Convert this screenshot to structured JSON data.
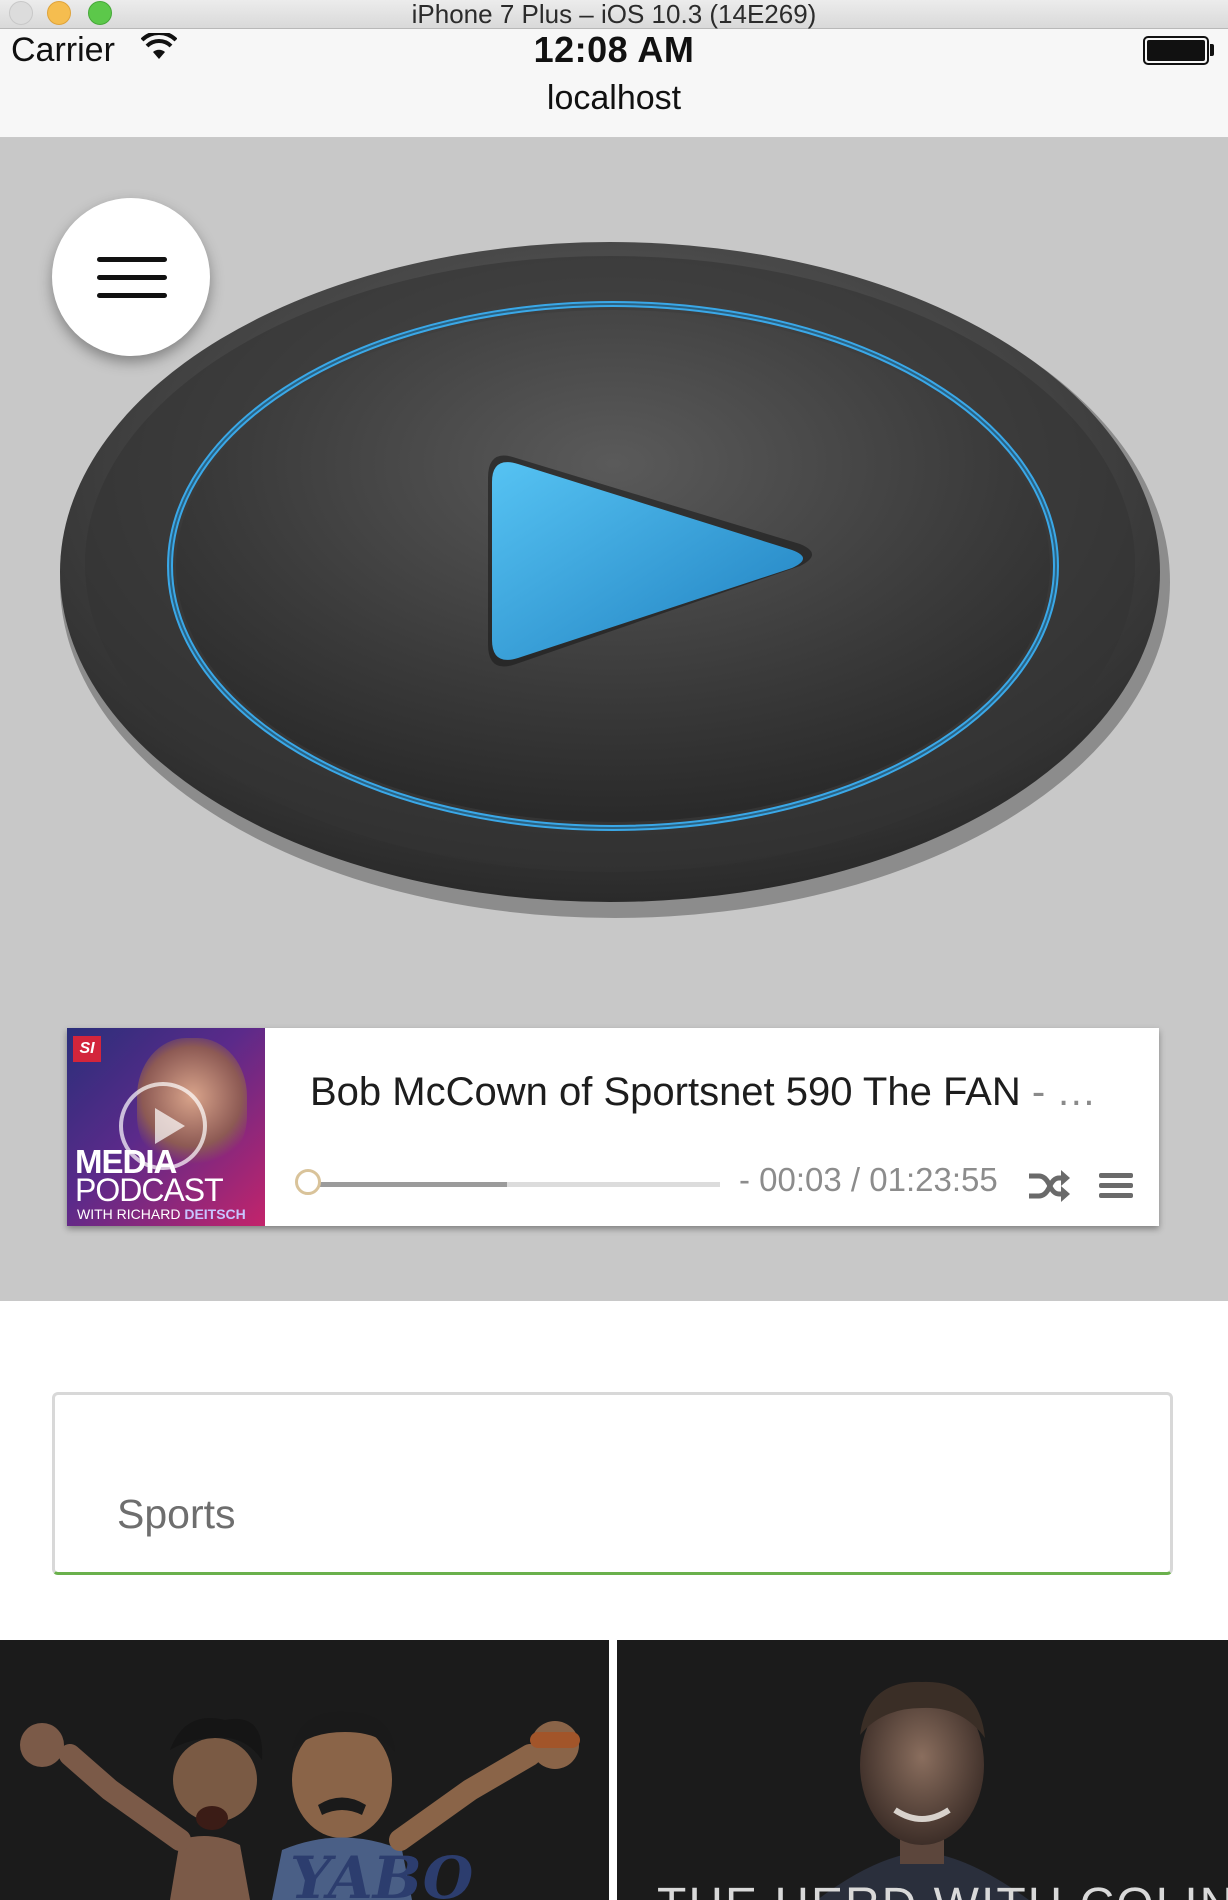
{
  "simulator": {
    "title": "iPhone 7 Plus – iOS 10.3 (14E269)"
  },
  "status_bar": {
    "carrier": "Carrier",
    "time": "12:08 AM",
    "address": "localhost"
  },
  "player": {
    "big_play_icon": "play-icon",
    "menu_icon": "hamburger-menu-icon"
  },
  "now_playing": {
    "artwork": {
      "badge": "SI",
      "line1": "MEDIA",
      "line2": "PODCAST",
      "line3_prefix": "WITH RICHARD ",
      "line3_name": "DEITSCH"
    },
    "title": "Bob McCown of Sportsnet 590 The FAN",
    "title_suffix": " - …",
    "time_display": "- 00:03 / 01:23:55",
    "elapsed": "00:03",
    "duration": "01:23:55",
    "buffered_fraction": 0.48,
    "shuffle_icon": "shuffle-icon",
    "playlist_icon": "list-icon"
  },
  "category_field": {
    "value": "Sports"
  },
  "tiles": [
    {
      "name": "show-tile-yabo",
      "image_text": "YABO"
    },
    {
      "name": "show-tile-herd",
      "caption": "THE HERD WITH COLIN"
    }
  ],
  "colors": {
    "accent_blue": "#3aa8e8",
    "field_underline": "#6ab04c",
    "hero_bg": "#c8c8c8"
  }
}
